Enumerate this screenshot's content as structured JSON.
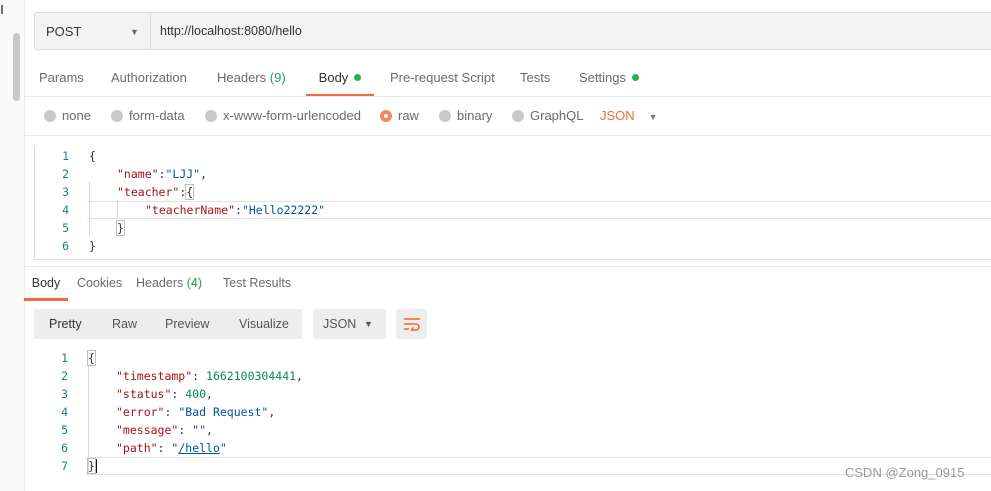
{
  "request": {
    "method": "POST",
    "url": "http://localhost:8080/hello"
  },
  "request_tabs": [
    {
      "label": "Params"
    },
    {
      "label": "Authorization"
    },
    {
      "label": "Headers",
      "count": "(9)"
    },
    {
      "label": "Body",
      "active": true,
      "indicator": true
    },
    {
      "label": "Pre-request Script"
    },
    {
      "label": "Tests"
    },
    {
      "label": "Settings",
      "indicator": true
    }
  ],
  "body_options": [
    {
      "label": "none",
      "selected": false
    },
    {
      "label": "form-data",
      "selected": false
    },
    {
      "label": "x-www-form-urlencoded",
      "selected": false
    },
    {
      "label": "raw",
      "selected": true
    },
    {
      "label": "binary",
      "selected": false
    },
    {
      "label": "GraphQL",
      "selected": false
    }
  ],
  "body_type": "JSON",
  "request_body_lines": [
    {
      "n": "1",
      "text": "{"
    },
    {
      "n": "2",
      "key": "\"name\"",
      "sep": ":",
      "value": "\"LJJ\"",
      "end": ","
    },
    {
      "n": "3",
      "key": "\"teacher\"",
      "sep": ":",
      "end": "{"
    },
    {
      "n": "4",
      "key": "\"teacherName\"",
      "sep": ":",
      "value": "\"Hello22222\""
    },
    {
      "n": "5",
      "text": "}"
    },
    {
      "n": "6",
      "text": "}"
    }
  ],
  "response_tabs": [
    {
      "label": "Body",
      "active": true
    },
    {
      "label": "Cookies"
    },
    {
      "label": "Headers",
      "count": "(4)"
    },
    {
      "label": "Test Results"
    }
  ],
  "view_modes": [
    "Pretty",
    "Raw",
    "Preview",
    "Visualize"
  ],
  "response_format": "JSON",
  "response_body_lines": [
    {
      "n": "1",
      "text": "{"
    },
    {
      "n": "2",
      "key": "\"timestamp\"",
      "sep": ": ",
      "num": "1662100304441",
      "end": ","
    },
    {
      "n": "3",
      "key": "\"status\"",
      "sep": ": ",
      "num": "400",
      "end": ","
    },
    {
      "n": "4",
      "key": "\"error\"",
      "sep": ": ",
      "value": "\"Bad Request\"",
      "end": ","
    },
    {
      "n": "5",
      "key": "\"message\"",
      "sep": ": ",
      "value": "\"\"",
      "end": ","
    },
    {
      "n": "6",
      "key": "\"path\"",
      "sep": ": ",
      "quote": "\"",
      "link": "/hello"
    },
    {
      "n": "7",
      "text": "}"
    }
  ],
  "watermark": "CSDN @Zong_0915",
  "colors": {
    "accent": "#f26b3a",
    "indicator": "#26b14c",
    "key": "#a31515",
    "string": "#0451a5",
    "number": "#098658"
  }
}
